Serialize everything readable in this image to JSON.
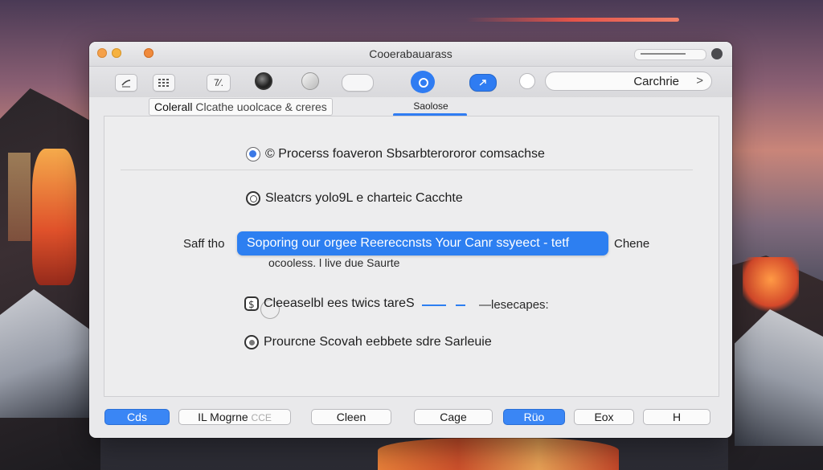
{
  "window": {
    "title": "Cooerabauarass",
    "search_value": "Carchrie",
    "search_chevron": ">"
  },
  "toolbar": {
    "btn_labels": [
      "",
      "",
      "7⁄.",
      "",
      "",
      ""
    ],
    "accent": "#2f7cf2"
  },
  "tabs": {
    "main_part1": "Colerall",
    "main_part2": "Clcathe uoolcace & creres",
    "selected": "Saolose"
  },
  "options": {
    "opt1": "© Procerss foaveron Sbsarbterororor comsachse",
    "opt2": "Sleatcrs yolo9L e charteic Cacchte",
    "prefix": "Saff tho",
    "highlight": "Soporing our orgee Reereccnsts Your Canr ssyeect - tetf",
    "suffix": "Chene",
    "sub": "ocooless. l  live due  Saurte",
    "opt4": "Cleeaselbl ees  twics tareS",
    "opt4_right": "—lesecapes:",
    "opt5": "Prourcne Scovah eebbete sdre Sarleuie"
  },
  "bottom": {
    "b1": "Cds",
    "b2": "IL Mogrne",
    "b2_faded": "CCE",
    "b3": "Cleen",
    "b4": "Cage",
    "b5": "Rüo",
    "b6": "Eox",
    "b7": "H"
  },
  "colors": {
    "accent": "#2d7ff1"
  }
}
